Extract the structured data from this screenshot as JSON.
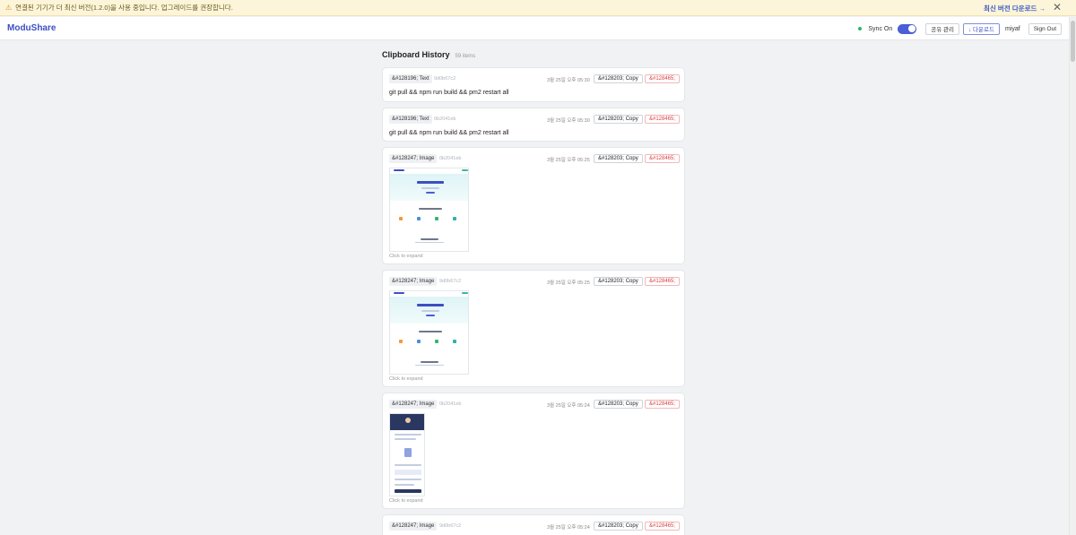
{
  "banner": {
    "icon": "warning-icon",
    "message": "연결된 기기가 더 최신 버전(1.2.0)을 사용 중입니다. 업그레이드를 권장합니다.",
    "download_link": "최신 버전 다운로드 →",
    "close": "✕"
  },
  "header": {
    "logo": "ModuShare",
    "sync_label": "Sync On",
    "share_manage": "공유 관리",
    "download": "↓ 다운로드",
    "user": "miyaf",
    "sign_out": "Sign Out"
  },
  "list": {
    "title": "Clipboard History",
    "count": "59 items",
    "expand_label": "Click to expand"
  },
  "items": [
    {
      "type_label": "&#128196; Text",
      "hash": "9d0b67c2",
      "time": "3월 25일 오후 05:30",
      "copy_label": "&#128203; Copy",
      "delete_label": "&#128465;",
      "content": "git pull && npm run build && pm2 restart all"
    },
    {
      "type_label": "&#128196; Text",
      "hash": "0b2041eb",
      "time": "3월 25일 오후 05:30",
      "copy_label": "&#128203; Copy",
      "delete_label": "&#128465;",
      "content": "git pull && npm run build && pm2 restart all"
    },
    {
      "type_label": "&#128247; Image",
      "hash": "0b2041eb",
      "time": "3월 25일 오후 05:25",
      "copy_label": "&#128203; Copy",
      "delete_label": "&#128465;"
    },
    {
      "type_label": "&#128247; Image",
      "hash": "9d0b67c2",
      "time": "3월 25일 오후 05:25",
      "copy_label": "&#128203; Copy",
      "delete_label": "&#128465;"
    },
    {
      "type_label": "&#128247; Image",
      "hash": "0b2041eb",
      "time": "3월 25일 오후 05:24",
      "copy_label": "&#128203; Copy",
      "delete_label": "&#128465;"
    },
    {
      "type_label": "&#128247; Image",
      "hash": "9d0b67c2",
      "time": "3월 25일 오후 05:24",
      "copy_label": "&#128203; Copy",
      "delete_label": "&#128465;"
    }
  ],
  "colors": {
    "accent": "#3d4fc2",
    "toggle_on": "#4a5ed6",
    "sync_dot": "#2fb36a",
    "delete": "#d94040",
    "banner_bg": "#fdf5d9"
  }
}
